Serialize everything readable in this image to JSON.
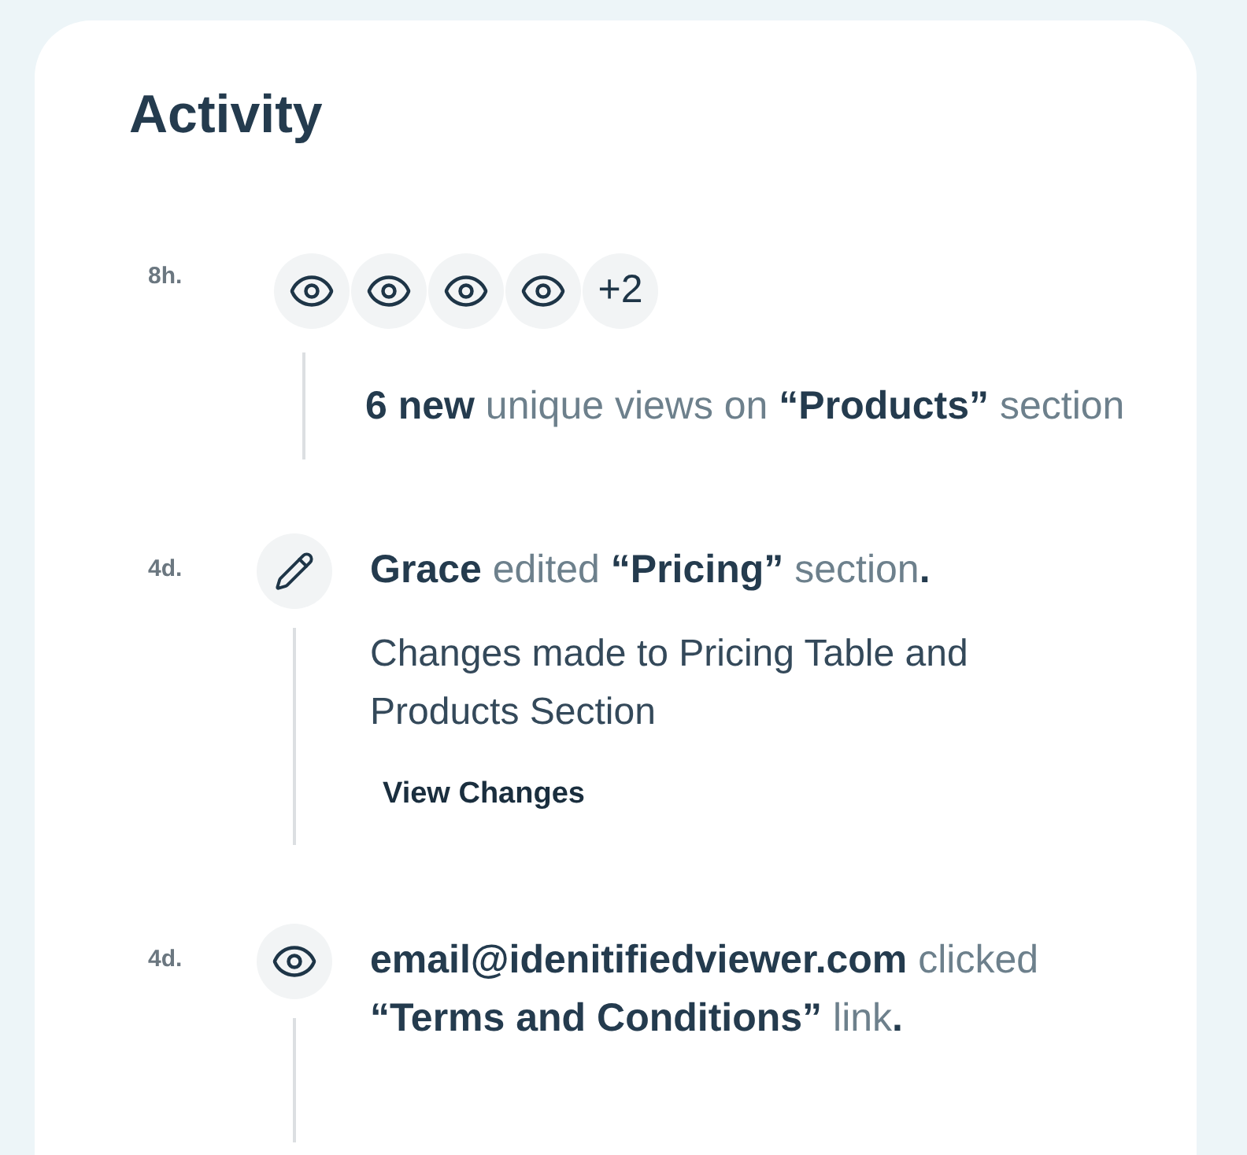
{
  "title": "Activity",
  "activities": [
    {
      "kind": "views",
      "time": "8h.",
      "viewers": [
        {
          "kind": "viewer"
        },
        {
          "kind": "viewer"
        },
        {
          "kind": "viewer"
        },
        {
          "kind": "viewer"
        },
        {
          "kind": "more",
          "label": "+2"
        }
      ],
      "text": "**6 new** unique views on **“Products”** section"
    },
    {
      "kind": "edit",
      "time": "4d.",
      "text": "**Grace** edited **“Pricing”** section**.**",
      "description": "Changes made to Pricing Table and Products Section",
      "action": "View Changes"
    },
    {
      "kind": "click",
      "time": "4d.",
      "text": "**email@idenitifiedviewer.com** clicked **“Terms and Conditions”** link**.**"
    }
  ]
}
